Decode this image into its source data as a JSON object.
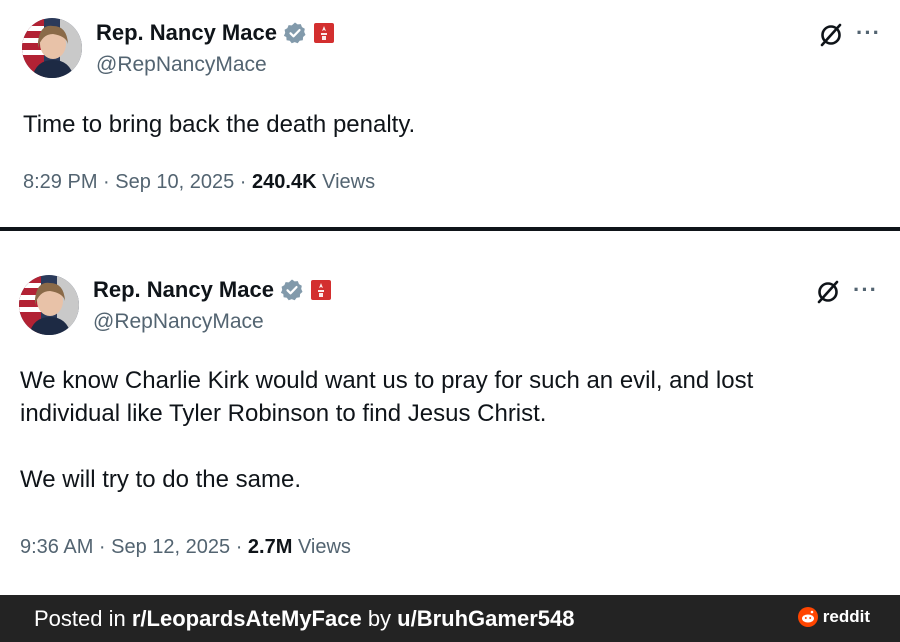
{
  "tweets": [
    {
      "name": "Rep. Nancy Mace",
      "handle": "@RepNancyMace",
      "text": "Time to bring back the death penalty.",
      "time": "8:29 PM · Sep 10, 2025 · ",
      "views_count": "240.4K",
      "views_label": " Views"
    },
    {
      "name": "Rep. Nancy Mace",
      "handle": "@RepNancyMace",
      "text": "We know Charlie Kirk would want us to pray for such an evil, and lost\nindividual like Tyler Robinson to find Jesus Christ.\n\nWe will try to do the same.",
      "time": "9:36 AM · Sep 12, 2025 · ",
      "views_count": "2.7M",
      "views_label": " Views"
    }
  ],
  "icons": {
    "verified": "verified-badge-icon",
    "affiliate": "congress-seal-icon",
    "grok": "grok-icon",
    "more": "more-icon"
  },
  "colors": {
    "verified": "#829aab",
    "affiliate": "#d32f2f",
    "footer_bg": "#232323",
    "reddit": "#ff4500"
  },
  "footer": {
    "prefix": "Posted in ",
    "subreddit": "r/LeopardsAteMyFace",
    "by": " by ",
    "user": "u/BruhGamer548",
    "brand": "reddit"
  }
}
